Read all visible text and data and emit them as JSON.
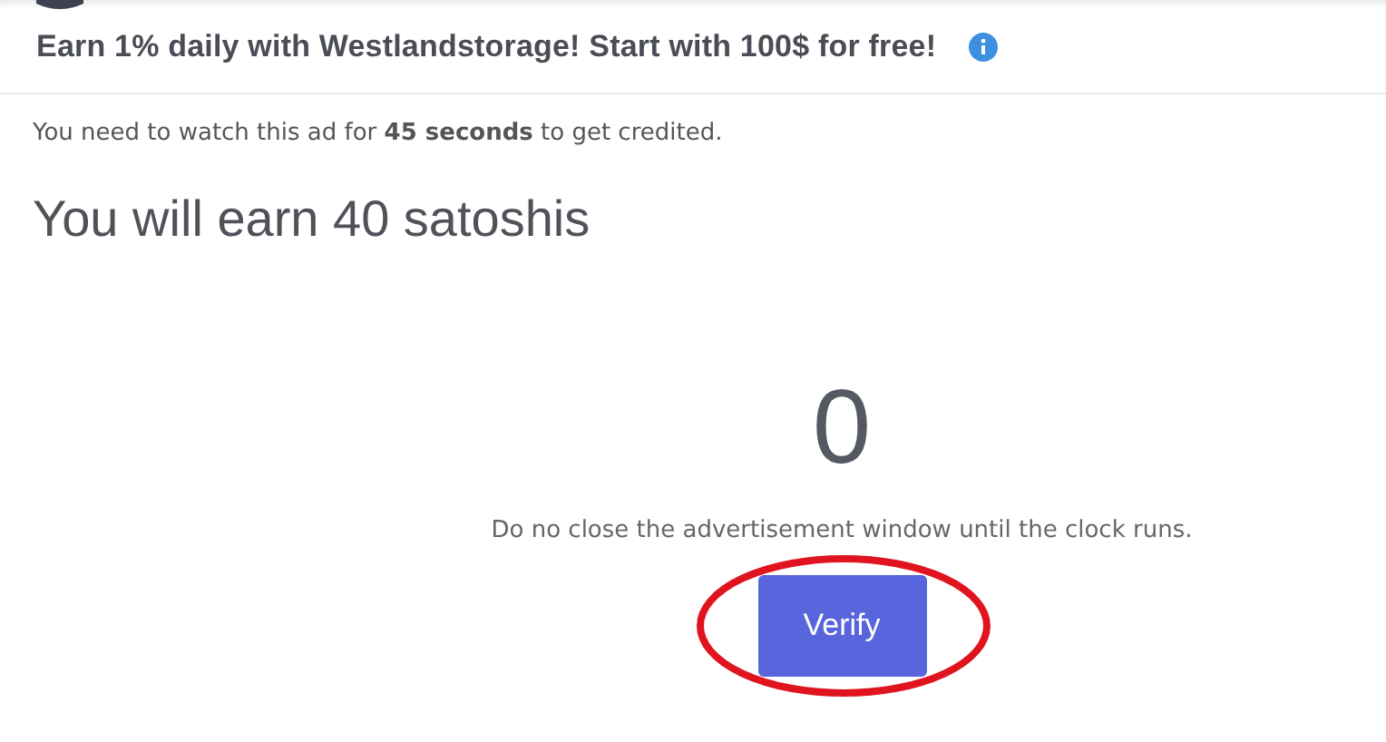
{
  "banner": {
    "text": "Earn 1% daily with Westlandstorage! Start with 100$ for free!"
  },
  "notice": "You need to watch this ad for **45 seconds** to get credited.",
  "heading": "You will earn 40 satoshis",
  "timer": "0",
  "message": "Do no close the advertisement window until the clock runs.",
  "button": {
    "label": "Verify",
    "highlighted": true
  }
}
